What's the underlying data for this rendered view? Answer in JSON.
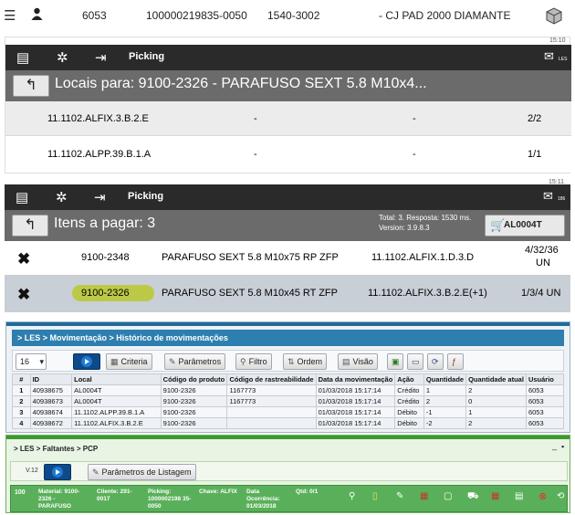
{
  "top_row": {
    "col1": "6053",
    "col2": "100000219835-0050",
    "col3": "1540-3002",
    "col4": "- CJ PAD 2000 DIAMANTE",
    "icons": [
      "list-icon",
      "user-icon",
      "box-icon"
    ]
  },
  "locais": {
    "time": "15:10",
    "header_label": "Picking",
    "header_badge": "LES",
    "title": "Locais para: 9100-2326 - PARAFUSO SEXT 5.8 M10x4...",
    "rows": [
      {
        "local": "11.1102.ALFIX.3.B.2.E",
        "a": "-",
        "b": "-",
        "qty": "2/2"
      },
      {
        "local": "11.1102.ALPP.39.B.1.A",
        "a": "-",
        "b": "-",
        "qty": "1/1"
      }
    ]
  },
  "itens": {
    "time": "15:11",
    "header_label": "Picking",
    "header_badge": "186",
    "title": "Itens a pagar: 3",
    "info_line1": "Total: 3. Resposta: 1530 ms.",
    "info_line2": "Version: 3.9.8.3",
    "cart_label": "AL0004T",
    "rows": [
      {
        "code": "9100-2348",
        "desc": "PARAFUSO SEXT 5.8 M10x75 RP ZFP",
        "local": "11.1102.ALFIX.1.D.3.D",
        "qty1": "4/32/36",
        "qty2": "UN"
      },
      {
        "code": "9100-2326",
        "desc": "PARAFUSO SEXT 5.8 M10x45 RT ZFP",
        "local": "11.1102.ALFIX.3.B.2.E(+1)",
        "qty1": "1/3/4 UN",
        "qty2": ""
      }
    ]
  },
  "historico": {
    "breadcrumb": "> LES > Movimentação > Histórico de movimentações",
    "page_size": "16",
    "buttons": {
      "criteria": "Criteria",
      "parametros": "Parâmetros",
      "filtro": "Filtro",
      "ordem": "Ordem",
      "visao": "Visão"
    },
    "columns": [
      "#",
      "ID",
      "Local",
      "Código do produto",
      "Código de rastreabilidade",
      "Data da movimentação",
      "Ação",
      "Quantidade",
      "Quantidade atual",
      "Usuário"
    ],
    "rows": [
      [
        "1",
        "40938675",
        "AL0004T",
        "9100-2326",
        "1167773",
        "01/03/2018 15:17:14",
        "Crédito",
        "1",
        "2",
        "6053"
      ],
      [
        "2",
        "40938673",
        "AL0004T",
        "9100-2326",
        "1167773",
        "01/03/2018 15:17:14",
        "Crédito",
        "2",
        "0",
        "6053"
      ],
      [
        "3",
        "40938674",
        "11.1102.ALPP.39.B.1.A",
        "9100-2326",
        "",
        "01/03/2018 15:17:14",
        "Débito",
        "-1",
        "1",
        "6053"
      ],
      [
        "4",
        "40938672",
        "11.1102.ALFIX.3.B.2.E",
        "9100-2326",
        "",
        "01/03/2018 15:17:14",
        "Débito",
        "-2",
        "2",
        "6053"
      ]
    ]
  },
  "faltantes": {
    "breadcrumb": "> LES > Faltantes > PCP",
    "version": "V.12",
    "params_label": "Parâmetros de Listagem",
    "row": {
      "num": "100",
      "material": "Material: 9100-2326 - PARAFUSO",
      "cliente": "Cliente: 291-0017",
      "picking": "Picking: 1000002198 35-0050",
      "chave": "Chave: ALFIX",
      "data": "Data Ocorrência: 01/03/2018",
      "qtd": "Qtd: 0/1"
    }
  }
}
